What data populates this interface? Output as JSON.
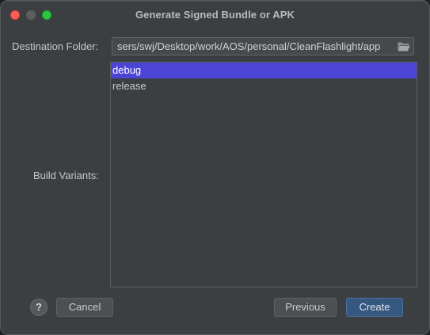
{
  "window": {
    "title": "Generate Signed Bundle or APK"
  },
  "destination": {
    "label": "Destination Folder:",
    "value": "sers/swj/Desktop/work/AOS/personal/CleanFlashlight/app",
    "button_icon": "folder-open-icon"
  },
  "build_variants": {
    "label": "Build Variants:",
    "items": [
      {
        "label": "debug",
        "selected": true
      },
      {
        "label": "release",
        "selected": false
      }
    ]
  },
  "footer": {
    "help_label": "?",
    "cancel_label": "Cancel",
    "previous_label": "Previous",
    "create_label": "Create"
  },
  "colors": {
    "selection": "#4b44d6",
    "default_button": "#365880",
    "close": "#ff5f57",
    "maximize": "#28c840"
  }
}
